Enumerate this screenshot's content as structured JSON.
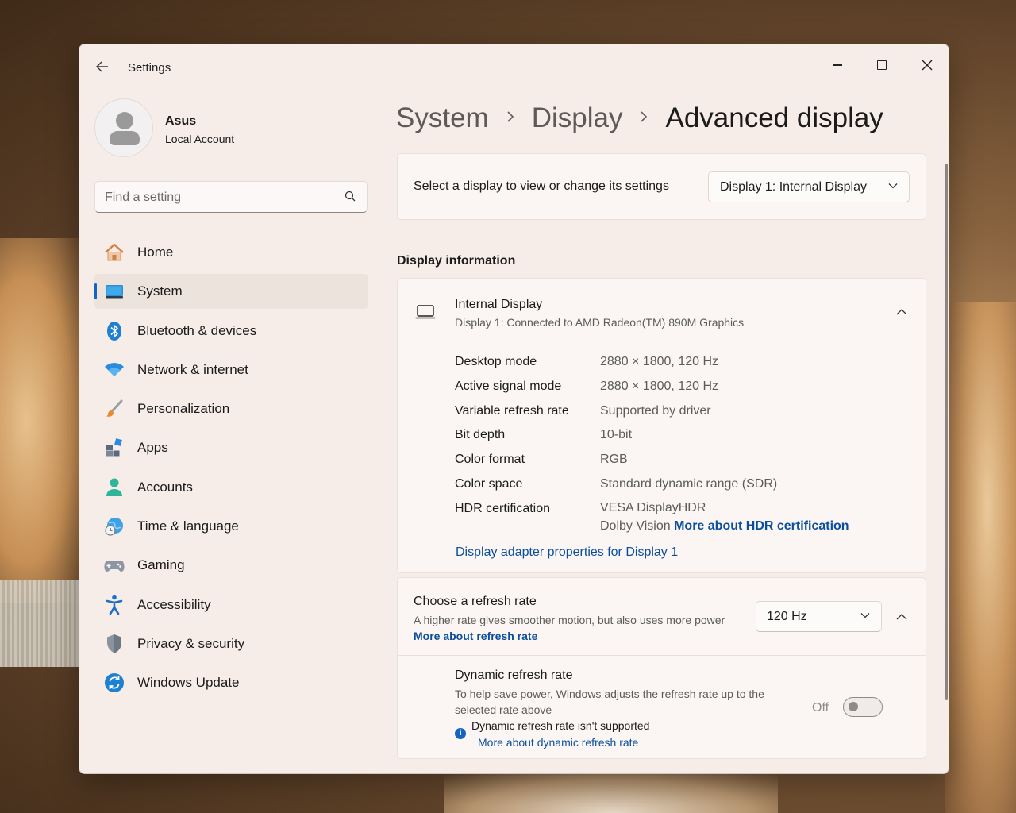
{
  "window": {
    "title": "Settings"
  },
  "user": {
    "name": "Asus",
    "account_type": "Local Account"
  },
  "search": {
    "placeholder": "Find a setting"
  },
  "sidebar": {
    "items": [
      {
        "label": "Home",
        "icon": "home-icon"
      },
      {
        "label": "System",
        "icon": "system-icon",
        "active": true
      },
      {
        "label": "Bluetooth & devices",
        "icon": "bluetooth-icon"
      },
      {
        "label": "Network & internet",
        "icon": "wifi-icon"
      },
      {
        "label": "Personalization",
        "icon": "brush-icon"
      },
      {
        "label": "Apps",
        "icon": "apps-icon"
      },
      {
        "label": "Accounts",
        "icon": "accounts-icon"
      },
      {
        "label": "Time & language",
        "icon": "globe-clock-icon"
      },
      {
        "label": "Gaming",
        "icon": "gamepad-icon"
      },
      {
        "label": "Accessibility",
        "icon": "accessibility-icon"
      },
      {
        "label": "Privacy & security",
        "icon": "shield-icon"
      },
      {
        "label": "Windows Update",
        "icon": "update-icon"
      }
    ]
  },
  "breadcrumb": {
    "parts": [
      "System",
      "Display"
    ],
    "current": "Advanced display"
  },
  "display_select": {
    "label": "Select a display to view or change its settings",
    "selected": "Display 1: Internal Display"
  },
  "display_info": {
    "section_title": "Display information",
    "title": "Internal Display",
    "subtitle": "Display 1: Connected to AMD Radeon(TM) 890M Graphics",
    "specs": [
      {
        "key": "Desktop mode",
        "value": "2880 × 1800, 120 Hz"
      },
      {
        "key": "Active signal mode",
        "value": "2880 × 1800, 120 Hz"
      },
      {
        "key": "Variable refresh rate",
        "value": "Supported by driver"
      },
      {
        "key": "Bit depth",
        "value": "10-bit"
      },
      {
        "key": "Color format",
        "value": "RGB"
      },
      {
        "key": "Color space",
        "value": "Standard dynamic range (SDR)"
      }
    ],
    "hdr": {
      "key": "HDR certification",
      "value_1": "VESA DisplayHDR",
      "value_2": "Dolby Vision",
      "link": "More about HDR certification"
    },
    "adapter_link": "Display adapter properties for Display 1"
  },
  "refresh": {
    "title": "Choose a refresh rate",
    "description": "A higher rate gives smoother motion, but also uses more power",
    "link": "More about refresh rate",
    "selected_rate": "120 Hz"
  },
  "dynamic_refresh": {
    "title": "Dynamic refresh rate",
    "description": "To help save power, Windows adjusts the refresh rate up to the selected rate above",
    "warning": "Dynamic refresh rate isn't supported",
    "link": "More about dynamic refresh rate",
    "toggle_label": "Off",
    "enabled": false
  },
  "colors": {
    "accent": "#1464c0",
    "link": "#0b4f9c",
    "window_bg": "#f6ede8"
  }
}
